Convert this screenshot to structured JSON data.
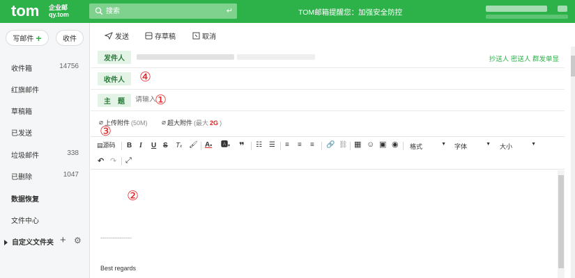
{
  "header": {
    "logo": "tom",
    "logo_sub1": "企业邮",
    "logo_sub2": "qy.tom",
    "search_placeholder": "搜索",
    "notice": "TOM邮箱提醒您：加强安全防控"
  },
  "sidebar": {
    "compose_label": "写邮件",
    "receive_label": "收件",
    "folders": [
      {
        "label": "收件箱",
        "count": "14756"
      },
      {
        "label": "红旗邮件",
        "count": ""
      },
      {
        "label": "草稿箱",
        "count": ""
      },
      {
        "label": "已发送",
        "count": ""
      },
      {
        "label": "垃圾邮件",
        "count": "338"
      },
      {
        "label": "已删除",
        "count": "1047"
      },
      {
        "label": "数据恢复",
        "count": ""
      },
      {
        "label": "文件中心",
        "count": ""
      }
    ],
    "custom_folder_label": "自定义文件夹"
  },
  "toolbar": {
    "send_label": "发送",
    "draft_label": "存草稿",
    "cancel_label": "取消"
  },
  "form": {
    "sender_label": "发件人",
    "recipient_label": "收件人",
    "subject_label": "主　题",
    "subject_placeholder": "请输入",
    "right_links": "抄送人  密送人  群发单显"
  },
  "attachments": {
    "upload_label": "上传附件",
    "upload_size": "(50M)",
    "large_label": "超大附件",
    "large_size_prefix": "(最大 ",
    "large_size_value": "2G",
    "large_size_suffix": ")"
  },
  "editor_toolbar": {
    "source_label": "源码",
    "format_label": "格式",
    "font_label": "字体",
    "size_label": "大小"
  },
  "editor": {
    "signature_divider": "---------------",
    "signature": "Best regards"
  },
  "annotations": {
    "n1": "①",
    "n2": "②",
    "n3": "③",
    "n4": "④"
  },
  "colors": {
    "brand_green": "#2db24a",
    "annotation_red": "#e02020"
  }
}
